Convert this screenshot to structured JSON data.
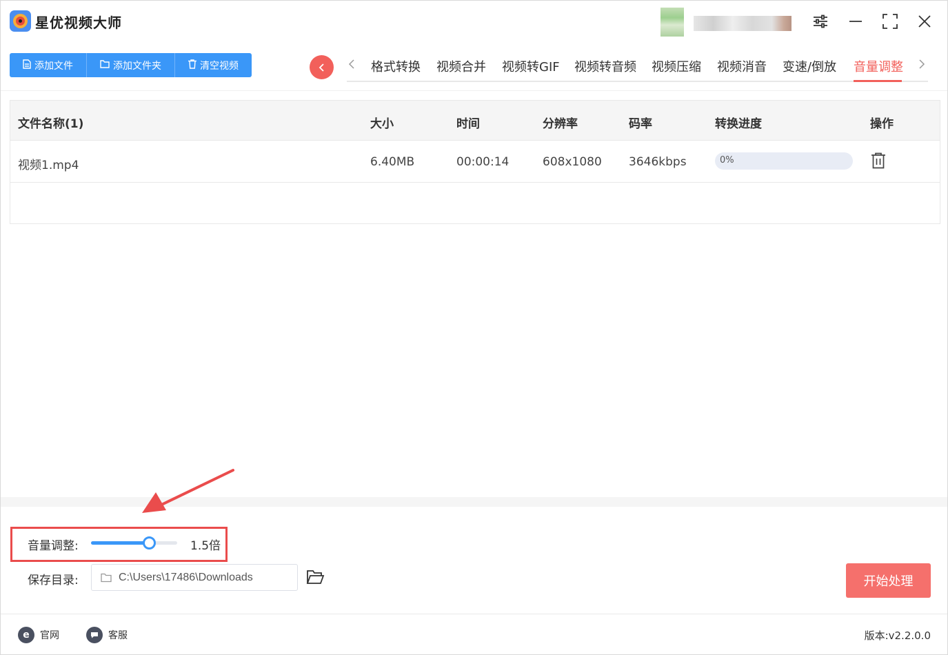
{
  "app": {
    "title": "星优视频大师"
  },
  "toolbar": {
    "add_file": "添加文件",
    "add_folder": "添加文件夹",
    "clear": "清空视频"
  },
  "tabs": [
    {
      "label": "格式转换"
    },
    {
      "label": "视频合并"
    },
    {
      "label": "视频转GIF"
    },
    {
      "label": "视频转音频"
    },
    {
      "label": "视频压缩"
    },
    {
      "label": "视频消音"
    },
    {
      "label": "变速/倒放"
    },
    {
      "label": "音量调整",
      "active": true
    }
  ],
  "table": {
    "headers": {
      "name": "文件名称(1)",
      "size": "大小",
      "time": "时间",
      "resolution": "分辨率",
      "bitrate": "码率",
      "progress": "转换进度",
      "action": "操作"
    },
    "rows": [
      {
        "name": "视频1.mp4",
        "size": "6.40MB",
        "time": "00:00:14",
        "resolution": "608x1080",
        "bitrate": "3646kbps",
        "progress_text": "0%",
        "progress": 0
      }
    ]
  },
  "volume": {
    "label": "音量调整:",
    "value_text": "1.5倍",
    "slider_fraction": 0.67
  },
  "save": {
    "label": "保存目录:",
    "path": "C:\\Users\\17486\\Downloads"
  },
  "actions": {
    "start": "开始处理"
  },
  "footer": {
    "website": "官网",
    "support": "客服",
    "version": "版本:v2.2.0.0"
  },
  "colors": {
    "primary": "#3a97f8",
    "accent": "#f2605b",
    "highlight_box": "#ea4c4c"
  }
}
